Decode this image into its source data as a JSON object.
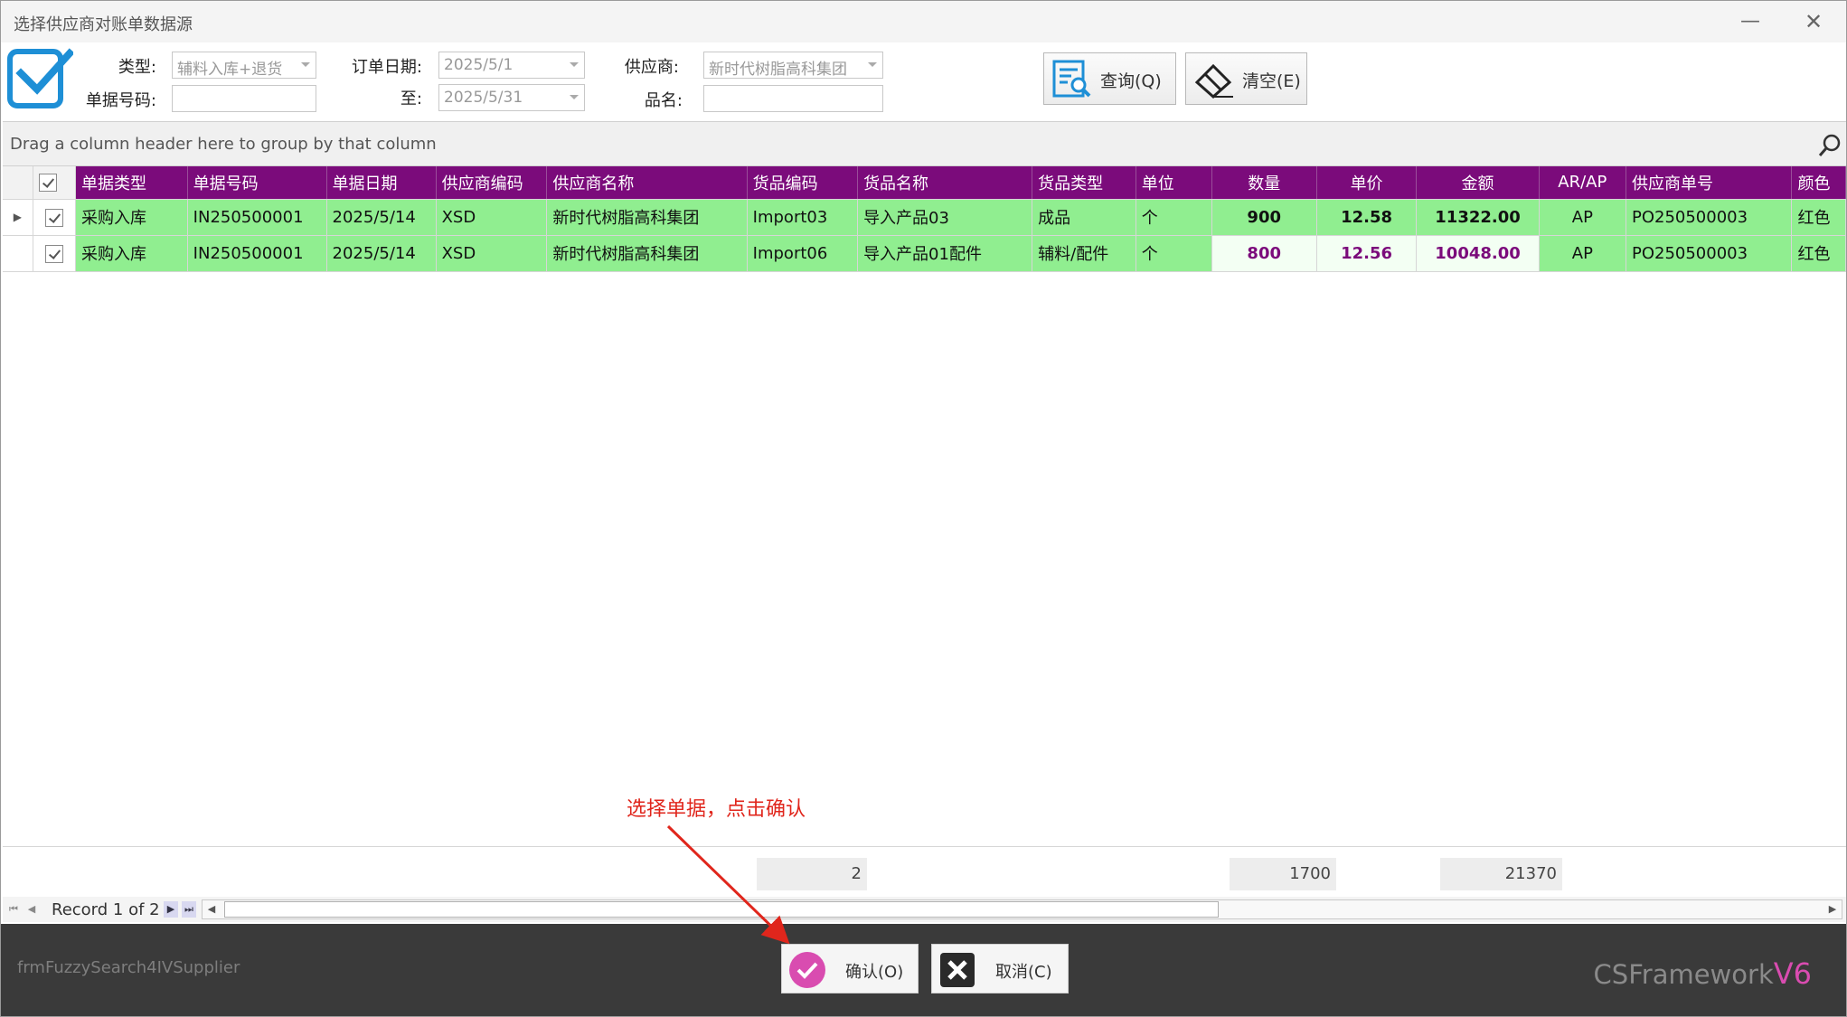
{
  "window": {
    "title": "选择供应商对账单数据源",
    "minimize_glyph": "—",
    "close_glyph": "✕"
  },
  "filters": {
    "type_label": "类型:",
    "type_value": "辅料入库+退货",
    "doc_no_label": "单据号码:",
    "doc_no_value": "",
    "order_date_label": "订单日期:",
    "order_date_from": "2025/5/1",
    "to_label": "至:",
    "order_date_to": "2025/5/31",
    "supplier_label": "供应商:",
    "supplier_value": "新时代树脂高科集团",
    "product_name_label": "品名:",
    "product_name_value": ""
  },
  "toolbar": {
    "query_label": "查询(Q)",
    "clear_label": "清空(E)"
  },
  "group_panel": {
    "hint": "Drag a column header here to group by that column"
  },
  "grid": {
    "columns": [
      "单据类型",
      "单据号码",
      "单据日期",
      "供应商编码",
      "供应商名称",
      "货品编码",
      "货品名称",
      "货品类型",
      "单位",
      "数量",
      "单价",
      "金额",
      "AR/AP",
      "供应商单号",
      "颜色"
    ],
    "rows": [
      {
        "doc_type": "采购入库",
        "doc_no": "IN250500001",
        "doc_date": "2025/5/14",
        "supplier_code": "XSD",
        "supplier_name": "新时代树脂高科集团",
        "product_code": "Import03",
        "product_name": "导入产品03",
        "product_type": "成品",
        "unit": "个",
        "qty": "900",
        "price": "12.58",
        "amount": "11322.00",
        "arap": "AP",
        "supplier_order": "PO250500003",
        "color": "红色"
      },
      {
        "doc_type": "采购入库",
        "doc_no": "IN250500001",
        "doc_date": "2025/5/14",
        "supplier_code": "XSD",
        "supplier_name": "新时代树脂高科集团",
        "product_code": "Import06",
        "product_name": "导入产品01配件",
        "product_type": "辅料/配件",
        "unit": "个",
        "qty": "800",
        "price": "12.56",
        "amount": "10048.00",
        "arap": "AP",
        "supplier_order": "PO250500003",
        "color": "红色"
      }
    ],
    "current_row_indicator": "▶"
  },
  "summary": {
    "count": "2",
    "qty_total": "1700",
    "amount_total": "21370"
  },
  "navigator": {
    "record_text": "Record 1 of 2",
    "first": "⏮",
    "prev": "◀",
    "next": "▶",
    "last": "⏭"
  },
  "annotation": {
    "text": "选择单据，点击确认",
    "color": "#e0261c"
  },
  "footer": {
    "form_name": "frmFuzzySearch4IVSupplier",
    "confirm_label": "确认(O)",
    "cancel_label": "取消(C)",
    "brand_prefix": "CSFramework",
    "brand_version": "V6"
  },
  "colors": {
    "header_bg": "#7b0b7b",
    "row_bg": "#90ee90",
    "accent_pink": "#d94cb0",
    "logo_blue": "#1e8fd6"
  }
}
